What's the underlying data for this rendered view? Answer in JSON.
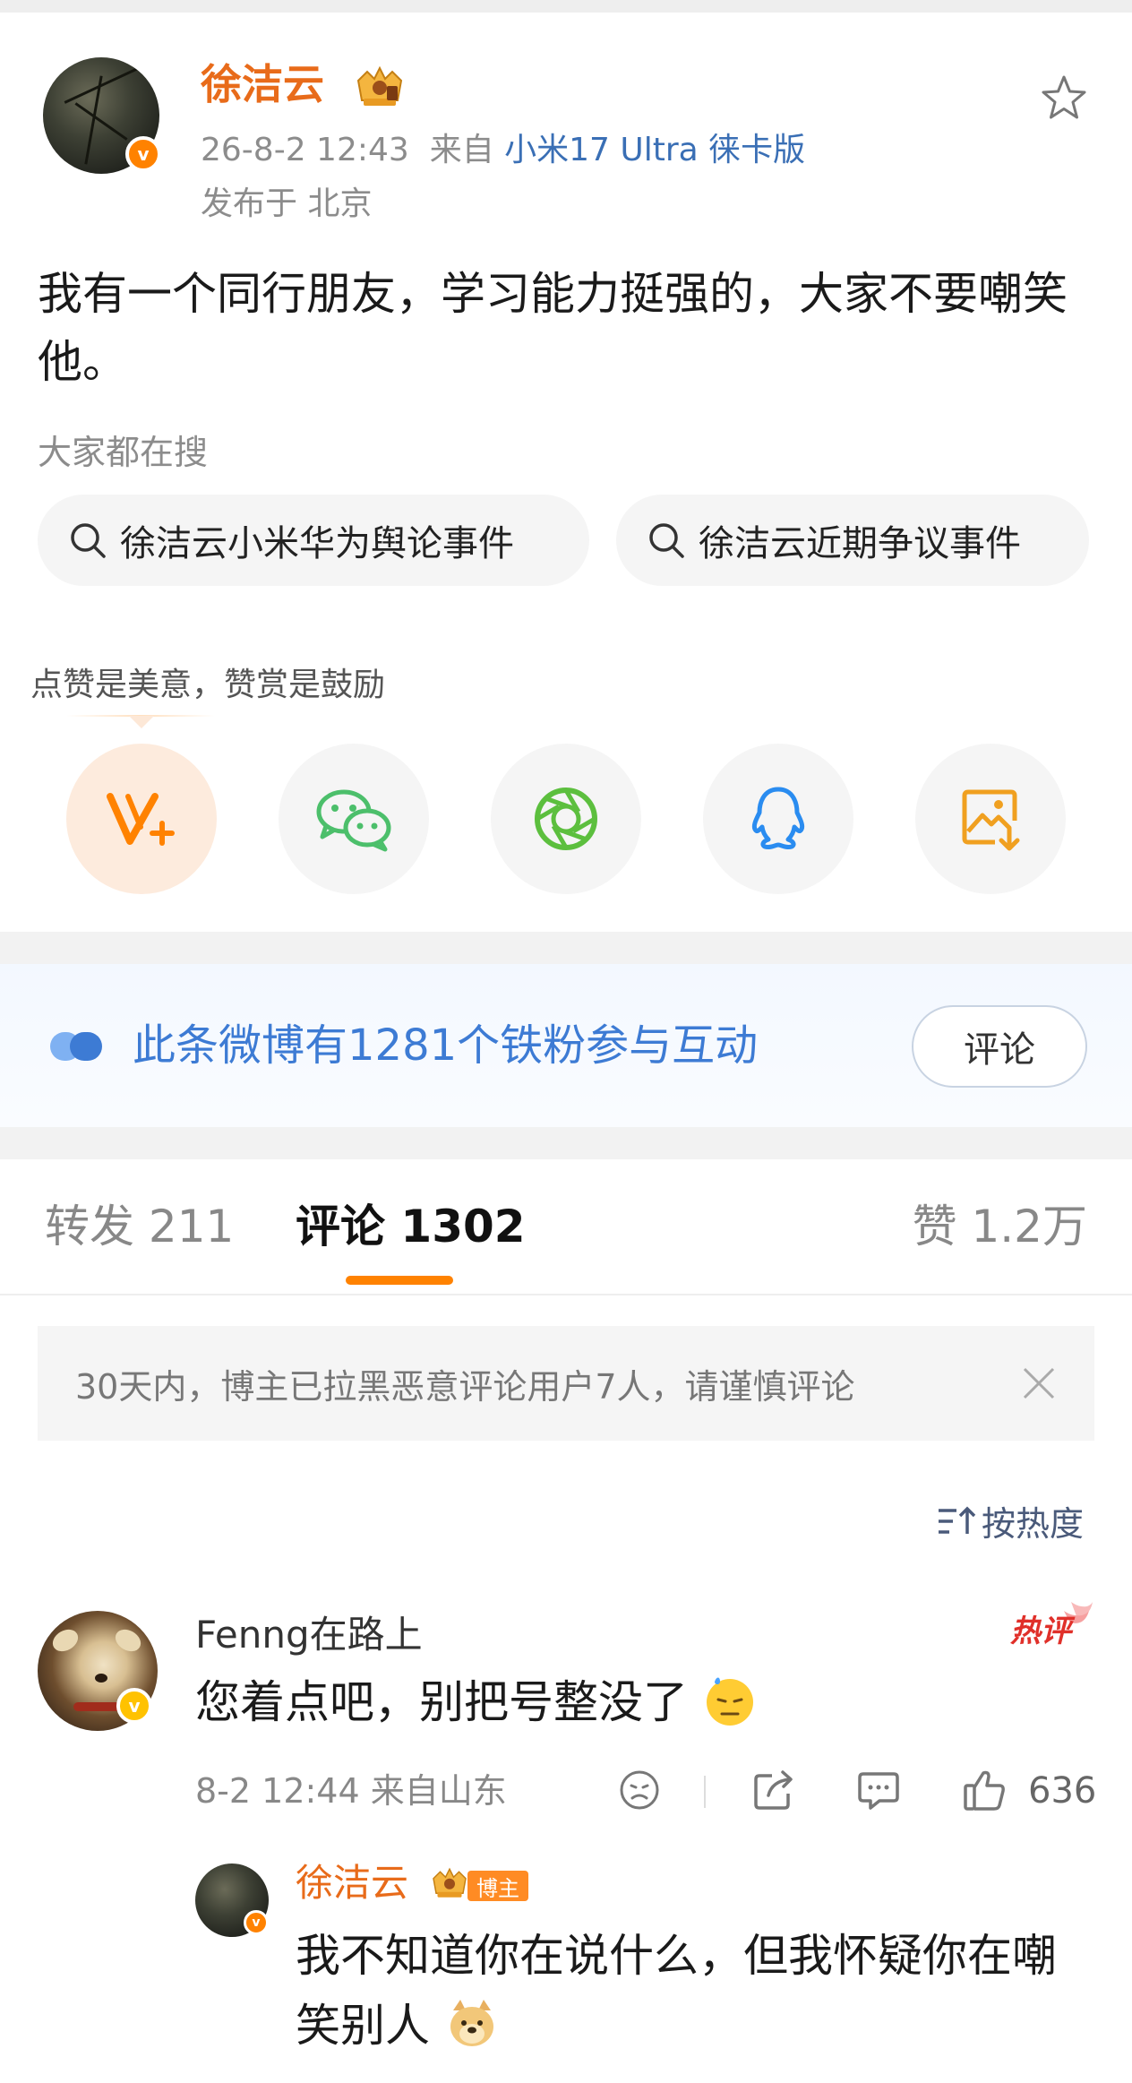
{
  "post": {
    "author_name": "徐洁云",
    "time": "26-8-2 12:43",
    "source_prefix": "来自",
    "device": "小米17 Ultra 徕卡版",
    "location": "发布于 北京",
    "text": "我有一个同行朋友，学习能力挺强的，大家不要嘲笑他。"
  },
  "search": {
    "title": "大家都在搜",
    "chips": [
      "徐洁云小米华为舆论事件",
      "徐洁云近期争议事件"
    ]
  },
  "reward": {
    "tip": "点赞是美意，赞赏是鼓励",
    "share_targets": [
      "V+",
      "wechat",
      "moments",
      "qq",
      "save-image"
    ]
  },
  "fans": {
    "text": "此条微博有1281个铁粉参与互动",
    "button": "评论"
  },
  "tabs": {
    "repost": "转发 211",
    "comment": "评论 1302",
    "like": "赞 1.2万"
  },
  "notice": {
    "text": "30天内，博主已拉黑恶意评论用户7人，请谨慎评论"
  },
  "sort": {
    "label": "按热度"
  },
  "comment": {
    "name": "Fenng在路上",
    "hot_tag": "热评",
    "text": "您着点吧，别把号整没了",
    "meta": "8-2 12:44 来自山东",
    "likes": "636"
  },
  "reply": {
    "name": "徐洁云",
    "badge": "博主",
    "text": "我不知道你在说什么，但我怀疑你在嘲笑别人"
  },
  "colors": {
    "accent": "#ff8200",
    "name_orange": "#e86b1a",
    "link_blue": "#3d7bd4"
  }
}
